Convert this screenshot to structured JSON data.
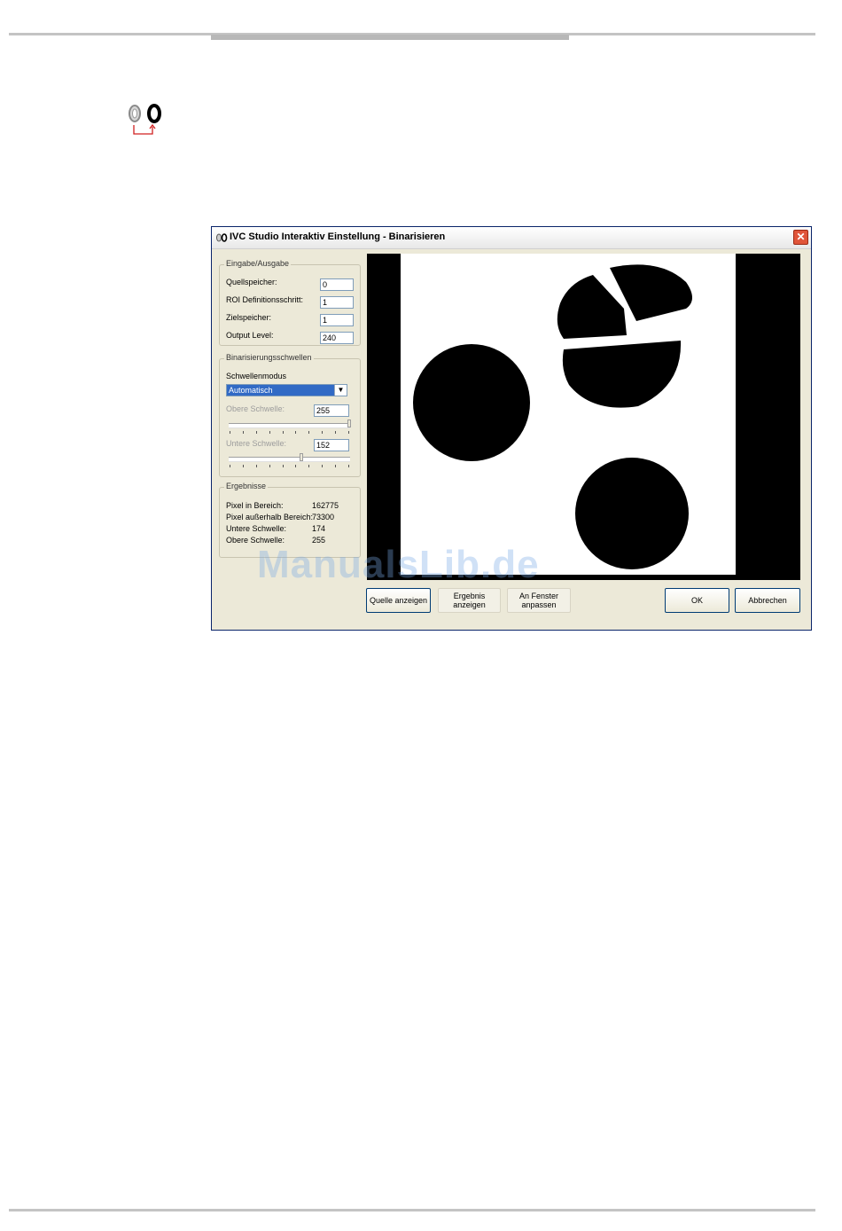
{
  "dialog": {
    "title": "IVC Studio Interaktiv Einstellung - Binarisieren",
    "close_label": "✕"
  },
  "io_group": {
    "legend": "Eingabe/Ausgabe",
    "fields": [
      {
        "label": "Quellspeicher:",
        "value": "0"
      },
      {
        "label": "ROI Definitionsschritt:",
        "value": "1"
      },
      {
        "label": "Zielspeicher:",
        "value": "1"
      },
      {
        "label": "Output Level:",
        "value": "240"
      }
    ]
  },
  "threshold_group": {
    "legend": "Binarisierungsschwellen",
    "mode_label": "Schwellenmodus",
    "mode_value": "Automatisch",
    "upper_label": "Obere Schwelle:",
    "upper_value": "255",
    "upper_level": 1.0,
    "lower_label": "Untere Schwelle:",
    "lower_value": "152",
    "lower_level": 0.6
  },
  "results_group": {
    "legend": "Ergebnisse",
    "rows": [
      {
        "label": "Pixel in Bereich:",
        "value": "162775"
      },
      {
        "label": "Pixel außerhalb Bereich:",
        "value": "73300"
      },
      {
        "label": "Untere Schwelle:",
        "value": "174"
      },
      {
        "label": "Obere Schwelle:",
        "value": "255"
      }
    ]
  },
  "buttons": {
    "show_source": "Quelle anzeigen",
    "show_result": "Ergebnis\nanzeigen",
    "fit_window": "An Fenster\nanpassen",
    "ok": "OK",
    "cancel": "Abbrechen"
  },
  "watermark": "ManualsLib.de"
}
